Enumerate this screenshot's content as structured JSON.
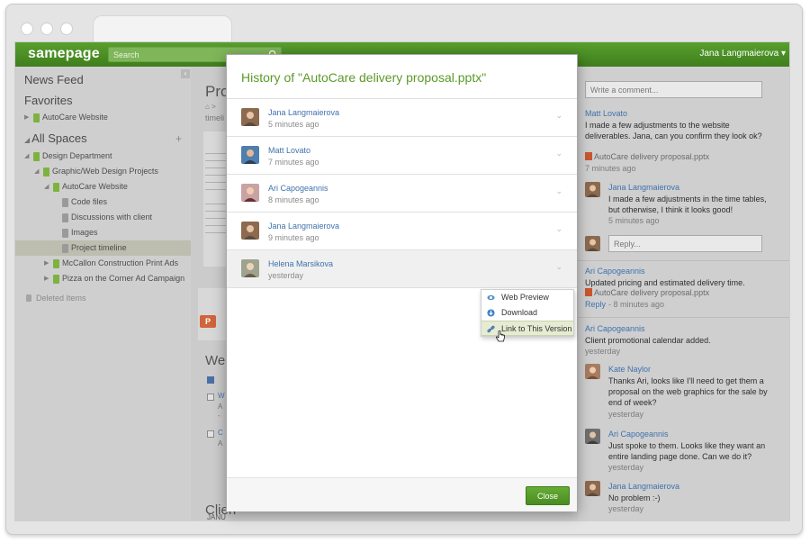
{
  "app": {
    "logo": "samepage",
    "user_menu": "Jana Langmaierova ▾"
  },
  "search": {
    "placeholder": "Search"
  },
  "sidebar": {
    "news_feed": "News Feed",
    "favorites": "Favorites",
    "favorites_items": [
      {
        "label": "AutoCare Website"
      }
    ],
    "all_spaces": "All Spaces",
    "add_symbol": "+",
    "tree": [
      {
        "label": "Design Department"
      },
      {
        "label": "Graphic/Web Design Projects"
      },
      {
        "label": "AutoCare Website"
      },
      {
        "label": "Code files"
      },
      {
        "label": "Discussions with client"
      },
      {
        "label": "Images"
      },
      {
        "label": "Project timeline"
      },
      {
        "label": "McCallon Construction Print Ads"
      },
      {
        "label": "Pizza on the Corner Ad Campaign"
      }
    ],
    "deleted_items": "Deleted Items"
  },
  "main": {
    "title_fragment": "Pro",
    "crumb_fragment": ">",
    "crumb2_fragment": "timeli",
    "section2_fragment": "Web",
    "section3_fragment": "Clien",
    "mini_items": [
      "W",
      "A",
      "-",
      "C",
      "A"
    ],
    "footer_fragment": "JANU"
  },
  "comments": {
    "input_placeholder": "Write a comment...",
    "reply_placeholder": "Reply...",
    "items": [
      {
        "name": "Matt Lovato",
        "text": "I made a few adjustments to the website deliverables. Jana, can you confirm they look ok?",
        "file": "AutoCare delivery proposal.pptx",
        "time": "7 minutes ago"
      },
      {
        "name": "Jana Langmaierova",
        "text": "I made a few adjustments in the time tables, but otherwise, I think it looks good!",
        "time": "5 minutes ago"
      },
      {
        "name": "Ari Capogeannis",
        "text": "Updated pricing and estimated delivery time.",
        "file": "AutoCare delivery proposal.pptx",
        "reply": "Reply",
        "time": "- 8 minutes ago"
      },
      {
        "name": "Ari Capogeannis",
        "text": "Client promotional calendar added.",
        "time": "yesterday"
      },
      {
        "name": "Kate Naylor",
        "text": "Thanks Ari, looks like I'll need to get them a proposal on the web graphics for the sale by end of week?",
        "time": "yesterday"
      },
      {
        "name": "Ari Capogeannis",
        "text": "Just spoke to them. Looks like they want an entire landing page done. Can we do it?",
        "time": "yesterday"
      },
      {
        "name": "Jana Langmaierova",
        "text": "No problem :-)",
        "time": "yesterday"
      }
    ]
  },
  "modal": {
    "title": "History of \"AutoCare delivery proposal.pptx\"",
    "versions": [
      {
        "name": "Jana Langmaierova",
        "time": "5 minutes ago"
      },
      {
        "name": "Matt Lovato",
        "time": "7 minutes ago"
      },
      {
        "name": "Ari Capogeannis",
        "time": "8 minutes ago"
      },
      {
        "name": "Jana Langmaierova",
        "time": "9 minutes ago"
      },
      {
        "name": "Helena Marsikova",
        "time": "yesterday"
      }
    ],
    "context_menu": {
      "web_preview": "Web Preview",
      "download": "Download",
      "link_version": "Link to This Version"
    },
    "close_label": "Close"
  },
  "colors": {
    "brand_green": "#4b8b22",
    "link_blue": "#3f72ad",
    "title_green": "#5c9a28"
  },
  "icons": [
    "search-icon",
    "chevron-down-icon",
    "eye-icon",
    "download-icon",
    "link-icon",
    "hand-cursor-icon",
    "folder-icon",
    "page-icon",
    "trash-icon",
    "powerpoint-icon"
  ]
}
